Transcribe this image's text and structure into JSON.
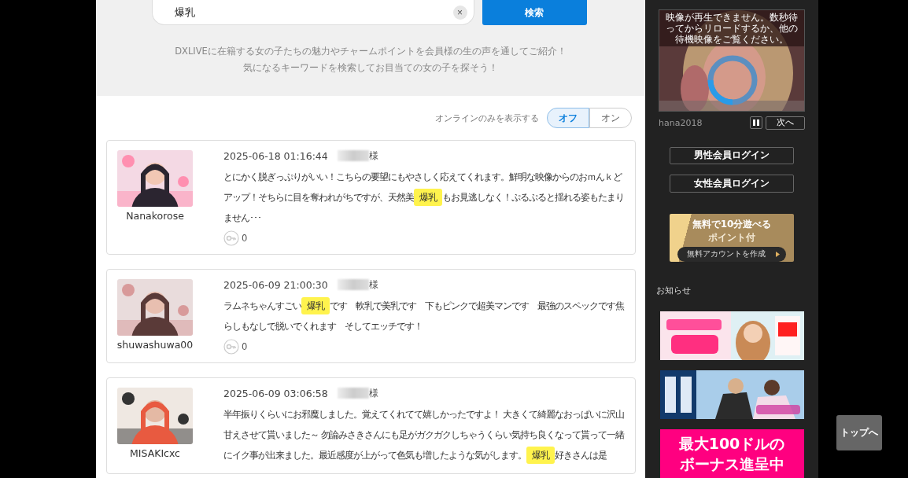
{
  "search": {
    "value": "爆乳",
    "clear_label": "×",
    "button": "検索"
  },
  "intro": [
    "DXLIVEに在籍する女の子たちの魅力やチャームポイントを会員様の生の声を通してご紹介！",
    "気になるキーワードを検索してお目当ての女の子を探そう！"
  ],
  "online_filter": {
    "label": "オンラインのみを表示する",
    "options": [
      {
        "label": "オフ",
        "selected": true
      },
      {
        "label": "オン",
        "selected": false
      }
    ]
  },
  "reviews": [
    {
      "performer": "Nanakorose",
      "photo": {
        "kind": "picture"
      },
      "date": "2025-06-18 01:16:44",
      "honorific": "様",
      "likes": "0",
      "text": [
        {
          "text": "とにかく脱ぎっぷりがいい！こちらの要望にもやさしく応えてくれます。鮮明な映像からのおｍんｋどアップ！そちらに目を奪われがちですが、天然美",
          "highlight": false
        },
        {
          "text": "爆乳",
          "highlight": true
        },
        {
          "text": "もお見逃しなく！ぷるぷると揺れる姿もたまりません･･･",
          "highlight": false
        }
      ]
    },
    {
      "performer": "shuwashuwa00",
      "photo": {
        "kind": "picture"
      },
      "date": "2025-06-09 21:00:30",
      "honorific": "様",
      "likes": "0",
      "text": [
        {
          "text": "ラムネちゃんすごい",
          "highlight": false
        },
        {
          "text": "爆乳",
          "highlight": true
        },
        {
          "text": "です　軟乳で美乳です　下もピンクで超美マンです　最強のスペックです焦らしもなしで脱いでくれます　そしてエッチです！",
          "highlight": false
        }
      ]
    },
    {
      "performer": "MISAKIcxc",
      "photo": {
        "kind": "picture"
      },
      "date": "2025-06-09 03:06:58",
      "honorific": "様",
      "text": [
        {
          "text": "半年振りくらいにお邪魔しました。覚えてくれてて嬉しかったですよ！ 大きくて綺麗なおっぱいに沢山甘えさせて貰いました～ 勿論みさきさんにも足がガクガクしちゃうくらい気持ち良くなって貰って一緒にイク事が出来ました。最近感度が上がって色気も増したような気がします。",
          "highlight": false
        },
        {
          "text": "爆乳",
          "highlight": true
        },
        {
          "text": "好きさんは是",
          "highlight": false
        }
      ]
    }
  ],
  "sidebar": {
    "video": {
      "message": "映像が再生できません。数秒待ってからリロードするか、他の待機映像をご覧ください。",
      "performer": "hana2018",
      "next_button": "次へ"
    },
    "login_buttons": [
      "男性会員ログイン",
      "女性会員ログイン"
    ],
    "promo": {
      "line1": "無料で10分遊べる",
      "line2": "ポイント付",
      "button": "無料アカウントを作成"
    },
    "news_title": "お知らせ",
    "banners": [
      {
        "kind": "picture"
      },
      {
        "kind": "picture"
      },
      {
        "kind": "text",
        "lines": [
          "最大100ドルの",
          "ボーナス進呈中"
        ]
      }
    ]
  },
  "back_to_top": "トップへ"
}
